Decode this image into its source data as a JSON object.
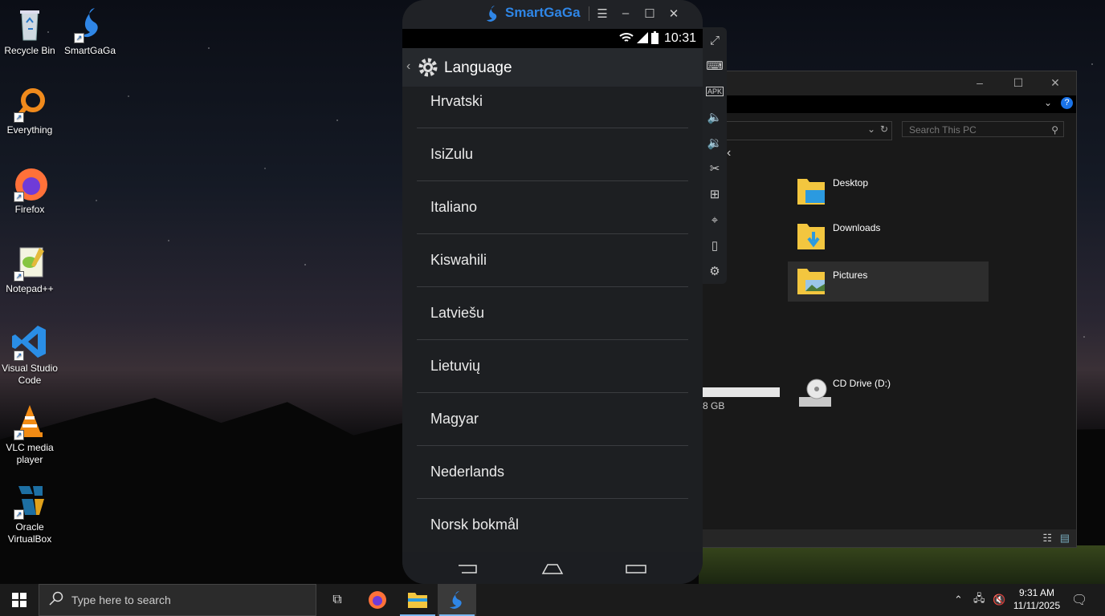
{
  "desktop": {
    "icons": [
      {
        "label": "Recycle Bin"
      },
      {
        "label": "SmartGaGa"
      },
      {
        "label": "Everything"
      },
      {
        "label": "Firefox"
      },
      {
        "label": "Notepad++"
      },
      {
        "label": "Visual Studio Code"
      },
      {
        "label": "VLC media player"
      },
      {
        "label": "Oracle VirtualBox"
      }
    ]
  },
  "emulator": {
    "brand": "SmartGaGa",
    "status_time": "10:31",
    "screen_title": "Language",
    "languages": [
      "Hrvatski",
      "IsiZulu",
      "Italiano",
      "Kiswahili",
      "Latviešu",
      "Lietuvių",
      "Magyar",
      "Nederlands",
      "Norsk bokmål"
    ],
    "toolbar_icons": [
      "fullscreen-icon",
      "keyboard-icon",
      "apk-icon",
      "volume-up-icon",
      "volume-down-icon",
      "scissors-icon",
      "add-window-icon",
      "location-icon",
      "shake-icon",
      "settings-icon"
    ]
  },
  "explorer": {
    "search_placeholder": "Search This PC",
    "folders": [
      {
        "label": "Desktop"
      },
      {
        "label": "Downloads"
      },
      {
        "label": "Pictures"
      }
    ],
    "drive_label": "CD Drive (D:)",
    "partial_size": "8 GB"
  },
  "taskbar": {
    "search_placeholder": "Type here to search",
    "time": "9:31 AM",
    "date": "11/11/2025"
  },
  "colors": {
    "accent": "#2f86e6",
    "taskbar": "#1b1b1b"
  }
}
